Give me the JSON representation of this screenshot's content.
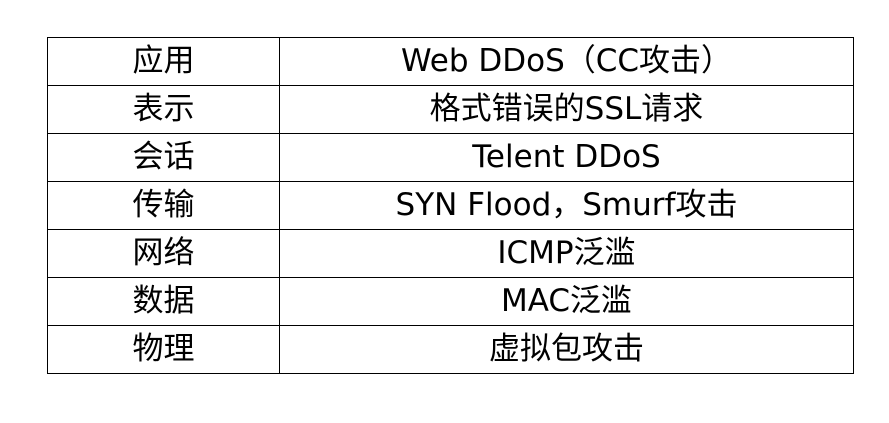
{
  "table": {
    "rows": [
      {
        "layer": "应用",
        "attack": "Web DDoS（CC攻击）"
      },
      {
        "layer": "表示",
        "attack": "格式错误的SSL请求"
      },
      {
        "layer": "会话",
        "attack": "Telent DDoS"
      },
      {
        "layer": "传输",
        "attack": "SYN Flood，Smurf攻击"
      },
      {
        "layer": "网络",
        "attack": "ICMP泛滥"
      },
      {
        "layer": "数据",
        "attack": "MAC泛滥"
      },
      {
        "layer": "物理",
        "attack": "虚拟包攻击"
      }
    ]
  }
}
